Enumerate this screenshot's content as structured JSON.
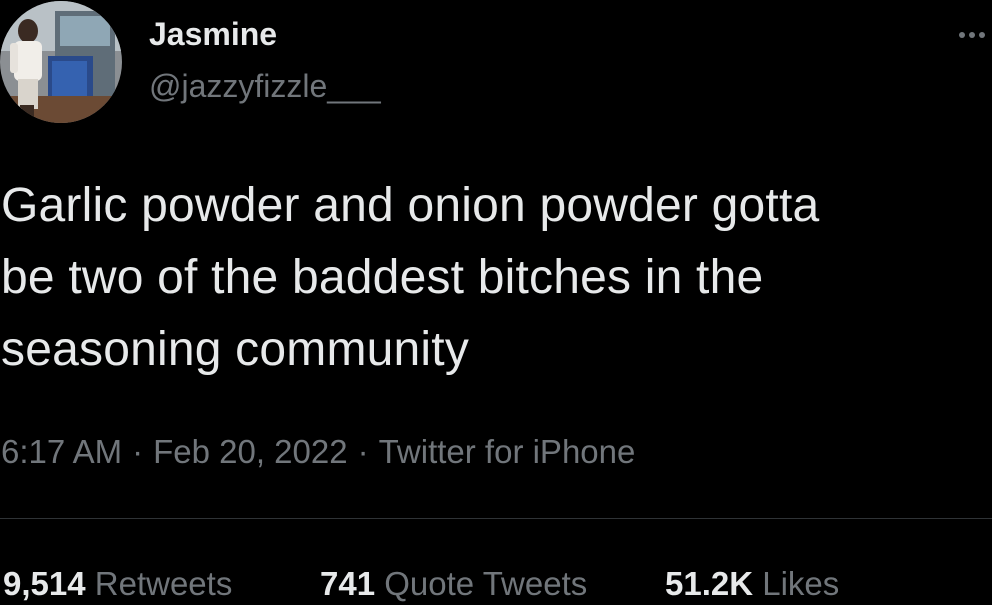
{
  "user": {
    "display_name": "Jasmine",
    "handle": "@jazzyfizzle___"
  },
  "tweet": {
    "lines": [
      "Garlic powder and onion powder gotta",
      "be two of the baddest bitches in the",
      "seasoning community"
    ]
  },
  "meta": {
    "time": "6:17 AM",
    "date": "Feb 20, 2022",
    "source": "Twitter for iPhone",
    "separator": "·"
  },
  "stats": {
    "retweets_count": "9,514",
    "retweets_label": "Retweets",
    "quotes_count": "741",
    "quotes_label": "Quote Tweets",
    "likes_count": "51.2K",
    "likes_label": "Likes"
  },
  "icons": {
    "more": "more-horizontal-icon"
  },
  "colors": {
    "background": "#000000",
    "primary_text": "#e7e9ea",
    "secondary_text": "#71767b",
    "divider": "#2f3336"
  }
}
